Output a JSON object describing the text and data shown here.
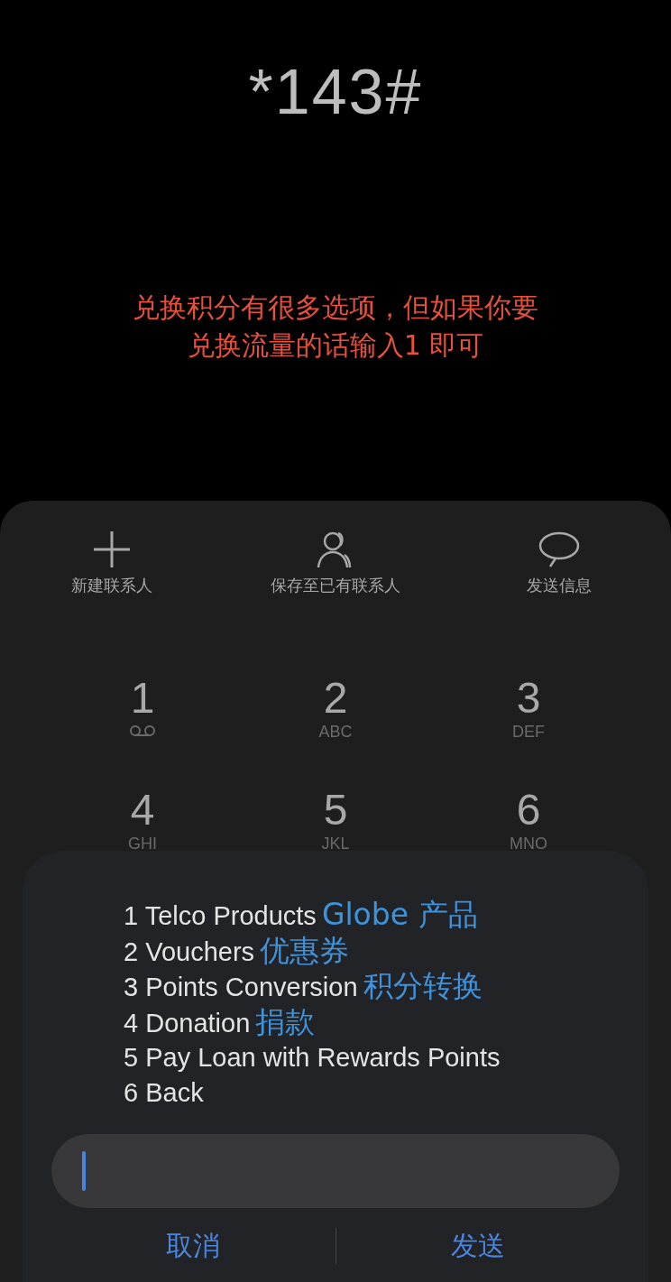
{
  "dialed_code": "*143#",
  "annotation": [
    "兑换积分有很多选项，但如果你要",
    "兑换流量的话输入1 即可"
  ],
  "actions": [
    {
      "kind": "add",
      "label": "新建联系人"
    },
    {
      "kind": "contact",
      "label": "保存至已有联系人"
    },
    {
      "kind": "message",
      "label": "发送信息"
    }
  ],
  "keys": [
    {
      "digit": "1",
      "kind": "voicemail"
    },
    {
      "digit": "2",
      "letters": "ABC"
    },
    {
      "digit": "3",
      "letters": "DEF"
    },
    {
      "digit": "4",
      "letters": "GHI"
    },
    {
      "digit": "5",
      "letters": "JKL"
    },
    {
      "digit": "6",
      "letters": "MNO"
    }
  ],
  "dialog": {
    "lines": [
      {
        "text": "1 Telco Products",
        "note": "Globe 产品"
      },
      {
        "text": "2 Vouchers",
        "note": "优惠券"
      },
      {
        "text": "3 Points Conversion",
        "note": "积分转换"
      },
      {
        "text": "4 Donation",
        "note": "捐款"
      },
      {
        "text": "5 Pay Loan with Rewards Points"
      },
      {
        "text": "6 Back"
      }
    ],
    "buttons": [
      "取消",
      "发送"
    ]
  }
}
